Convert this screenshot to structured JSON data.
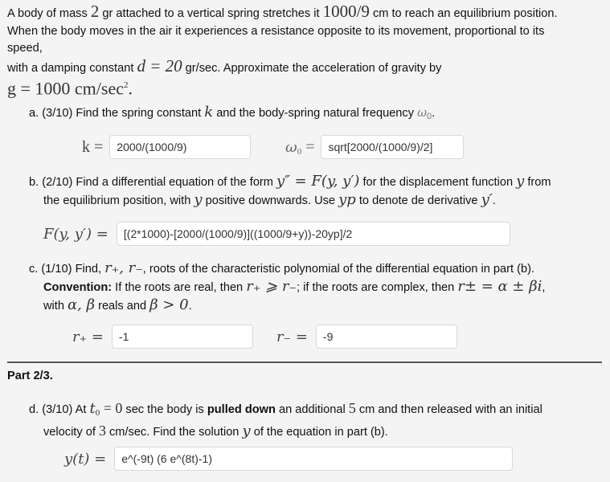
{
  "intro": {
    "l1_a": "A body of mass ",
    "mass": "2",
    "l1_b": " gr attached to a vertical spring stretches it ",
    "stretch": "1000/9",
    "l1_c": " cm to reach an equilibrium position.",
    "l2": "When the body moves in the air it experiences a resistance opposite to its movement, proportional to its",
    "l3": "speed,",
    "l4_a": "with a damping constant ",
    "d_eq": "d = 20",
    "l4_b": " gr/sec. Approximate the acceleration of gravity by",
    "g_eq": "g = 1000 cm/sec",
    "g_exp": "2",
    "g_end": "."
  },
  "part_a": {
    "prefix": "a. (3/10) Find the spring constant ",
    "k": "k",
    "mid": " and the body-spring natural frequency ",
    "w": "ω",
    "w_sub": "0",
    "end": ".",
    "k_label": "k =",
    "k_value": "2000/(1000/9)",
    "w_label": "ω",
    "w_label_sub": "0",
    "w_label_eq": " =",
    "w_value": "sqrt[2000/(1000/9)/2]"
  },
  "part_b": {
    "prefix": "b. (2/10) Find a differential equation of the form ",
    "form": "y″ = F(y, y′)",
    "mid": " for the displacement function ",
    "y": "y",
    "end1": " from",
    "l2_a": "the equilibrium position, with ",
    "l2_y": "y",
    "l2_b": " positive downwards. Use ",
    "yp": "yp",
    "l2_c": " to denote de derivative ",
    "yprime": "y′",
    "l2_end": ".",
    "F_label": "F(y, y′) =",
    "F_value": "[(2*1000)-[2000/(1000/9)]((1000/9+y))-20yp]/2"
  },
  "part_c": {
    "prefix": "c. (1/10) Find, ",
    "roots": "r₊, r₋",
    "l1_end": ", roots of the characteristic polynomial of the differential equation in part (b).",
    "conv_label": "Convention:",
    "conv_a": " If the roots are real, then ",
    "conv_ineq": "r₊ ⩾ r₋",
    "conv_b": "; if the roots are complex, then ",
    "conv_complex": "r± = α ± βi",
    "conv_end": ",",
    "l3_a": "with ",
    "ab": "α, β",
    "l3_b": " reals and ",
    "bpos": "β > 0",
    "l3_end": ".",
    "rp_label": "r₊ =",
    "rp_value": "-1",
    "rm_label": "r₋ =",
    "rm_value": "-9"
  },
  "part_header": "Part 2/3.",
  "part_d": {
    "prefix": "d. (3/10) At ",
    "t0": "t",
    "t0_sub": "0",
    "t0_eq": " = 0",
    "a": " sec the body is ",
    "bold": "pulled down",
    "b": " an additional ",
    "five": "5",
    "c": " cm and then released with an initial",
    "l2_a": "velocity of ",
    "three": "3",
    "l2_b": " cm/sec. Find the solution ",
    "y": "y",
    "l2_c": " of the equation in part (b).",
    "y_label": "y(t) =",
    "y_value": "e^(-9t) (6 e^(8t)-1)"
  }
}
